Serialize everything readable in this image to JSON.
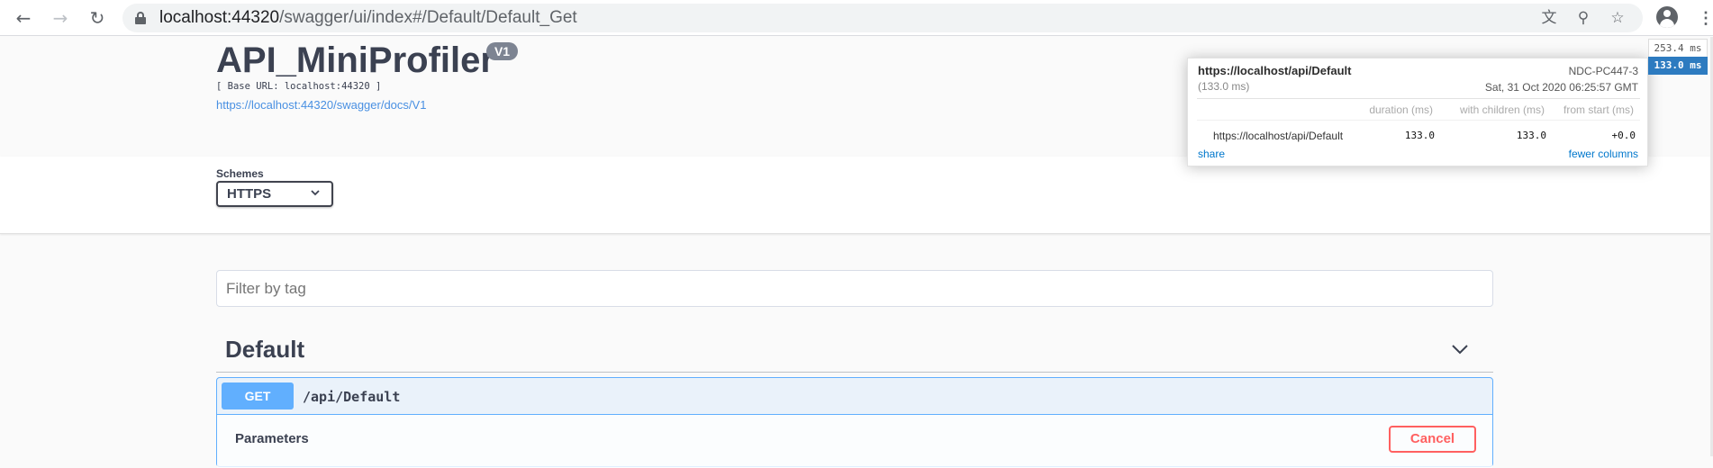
{
  "browser": {
    "url_host": "localhost:44320",
    "url_path": "/swagger/ui/index#/Default/Default_Get",
    "icons": {
      "back": "back-arrow-icon",
      "forward": "forward-arrow-icon",
      "reload": "reload-icon",
      "lock": "lock-icon",
      "translate": "translate-icon",
      "zoom": "zoom-icon",
      "bookmark": "star-icon",
      "profile": "profile-icon",
      "menu": "kebab-menu-icon"
    }
  },
  "info": {
    "title": "API_MiniProfiler",
    "version": "V1",
    "base_url": "[ Base URL: localhost:44320 ]",
    "docs_link": "https://localhost:44320/swagger/docs/V1"
  },
  "schemes": {
    "label": "Schemes",
    "selected": "HTTPS"
  },
  "filter": {
    "placeholder": "Filter by tag"
  },
  "tag": {
    "name": "Default"
  },
  "operation": {
    "method": "GET",
    "path": "/api/Default",
    "params_label": "Parameters",
    "cancel_label": "Cancel"
  },
  "miniprofiler": {
    "name": "https://localhost/api/Default",
    "machine": "NDC-PC447-3",
    "duration": "(133.0 ms)",
    "date": "Sat, 31 Oct 2020 06:25:57 GMT",
    "columns": [
      "duration (ms)",
      "with children (ms)",
      "from start (ms)"
    ],
    "row": {
      "label": "https://localhost/api/Default",
      "duration": "133.0",
      "with_children": "133.0",
      "from_start": "+0.0"
    },
    "share_label": "share",
    "fewer_columns_label": "fewer columns",
    "results": [
      "253.4 ms",
      "133.0 ms"
    ]
  },
  "colors": {
    "get_method": "#61affe",
    "cancel": "#ff6060",
    "link": "#4990e2",
    "text": "#3b4151",
    "profiler_selected": "#2d7bc0"
  }
}
